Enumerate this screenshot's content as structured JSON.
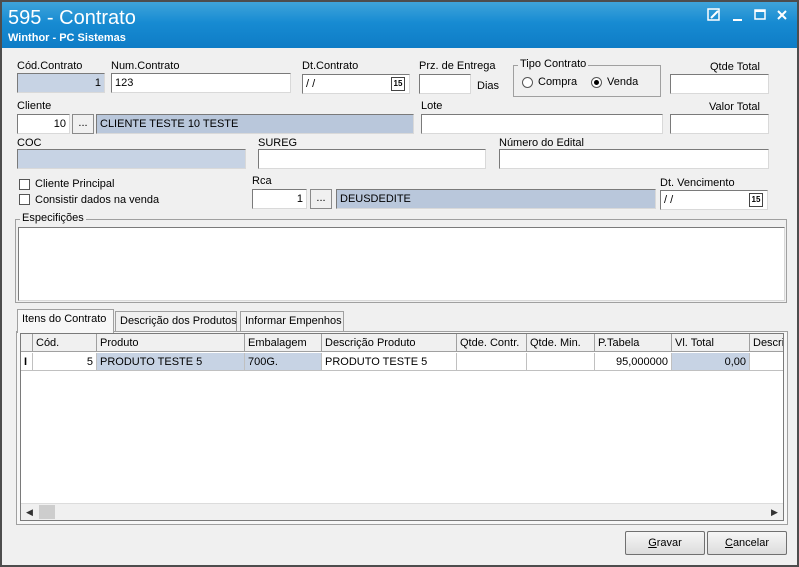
{
  "window": {
    "title": "595 - Contrato",
    "subtitle": "Winthor - PC Sistemas"
  },
  "form": {
    "cod_contrato": {
      "label": "Cód.Contrato",
      "value": "1"
    },
    "num_contrato": {
      "label": "Num.Contrato",
      "value": "123"
    },
    "dt_contrato": {
      "label": "Dt.Contrato",
      "value": "/ /"
    },
    "prz_entrega": {
      "label": "Prz. de Entrega",
      "value": "",
      "suffix": "Dias"
    },
    "tipo_contrato": {
      "label": "Tipo Contrato",
      "option_compra": "Compra",
      "option_venda": "Venda",
      "selected": "Venda"
    },
    "qtde_total": {
      "label": "Qtde Total",
      "value": ""
    },
    "cliente": {
      "label": "Cliente",
      "code": "10",
      "name": "CLIENTE TESTE 10 TESTE",
      "lookup_label": "..."
    },
    "lote": {
      "label": "Lote",
      "value": ""
    },
    "valor_total": {
      "label": "Valor Total",
      "value": ""
    },
    "coc": {
      "label": "COC",
      "value": ""
    },
    "sureg": {
      "label": "SUREG",
      "value": ""
    },
    "numero_edital": {
      "label": "Número do Edital",
      "value": ""
    },
    "cliente_principal": {
      "label": "Cliente Principal",
      "checked": false
    },
    "consistir_dados": {
      "label": "Consistir dados na venda",
      "checked": false
    },
    "rca": {
      "label": "Rca",
      "code": "1",
      "name": "DEUSDEDITE",
      "lookup_label": "..."
    },
    "dt_vencimento": {
      "label": "Dt. Vencimento",
      "value": "/ /"
    },
    "especificacoes": {
      "label": "Especifições",
      "value": ""
    },
    "calendar_icon_text": "15"
  },
  "tabs": [
    {
      "label": "Itens do Contrato",
      "active": true
    },
    {
      "label": "Descrição dos Produtos",
      "active": false
    },
    {
      "label": "Informar Empenhos",
      "active": false
    }
  ],
  "grid": {
    "columns": [
      "Cód.",
      "Produto",
      "Embalagem",
      "Descrição Produto",
      "Qtde. Contr.",
      "Qtde. Min.",
      "P.Tabela",
      "Vl. Total",
      "Descri"
    ],
    "rows": [
      {
        "indicator": "I",
        "cod": "5",
        "produto": "PRODUTO TESTE 5",
        "embalagem": "700G.",
        "descricao": "PRODUTO TESTE 5",
        "qtde_contr": "",
        "qtde_min": "",
        "p_tabela": "95,000000",
        "vl_total": "0,00",
        "descri": ""
      }
    ]
  },
  "buttons": {
    "gravar": "Gravar",
    "cancelar": "Cancelar"
  },
  "colors": {
    "titlebar": "#178bd2",
    "readonly_field": "#c7d3e4"
  }
}
